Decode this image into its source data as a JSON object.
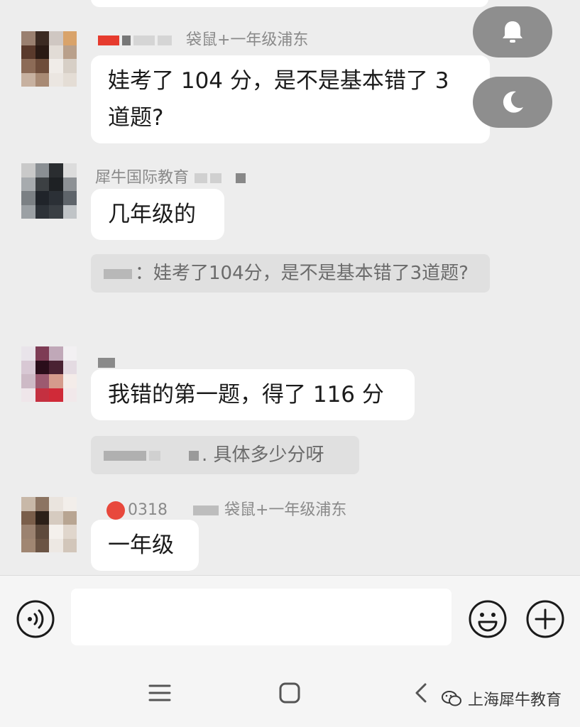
{
  "messages": [
    {
      "sender": "袋鼠+一年级浦东",
      "text": "娃考了 104 分，是不是基本错了 3 道题?"
    },
    {
      "sender": "犀牛国际教育",
      "text": "几年级的",
      "quote": "：娃考了104分，是不是基本错了3道题?"
    },
    {
      "sender": "",
      "text": "我错的第一题，得了 116 分",
      "quote": ". 具体多少分呀"
    },
    {
      "sender_id": "0318",
      "sender": "袋鼠+一年级浦东",
      "text": "一年级"
    }
  ],
  "floating_buttons": {
    "notify_icon": "bell-icon",
    "night_icon": "moon-icon"
  },
  "input": {
    "placeholder": "",
    "voice_icon": "voice-icon",
    "emoji_icon": "emoji-icon",
    "plus_icon": "plus-icon"
  },
  "nav": {
    "menu_icon": "menu-icon",
    "home_icon": "home-icon",
    "back_icon": "back-icon"
  },
  "watermark": {
    "text": "上海犀牛教育",
    "icon": "wechat-icon"
  },
  "colors": {
    "background": "#ededed",
    "bubble": "#ffffff",
    "quote": "#e0e0e0",
    "float_button": "#8e8e8e"
  }
}
